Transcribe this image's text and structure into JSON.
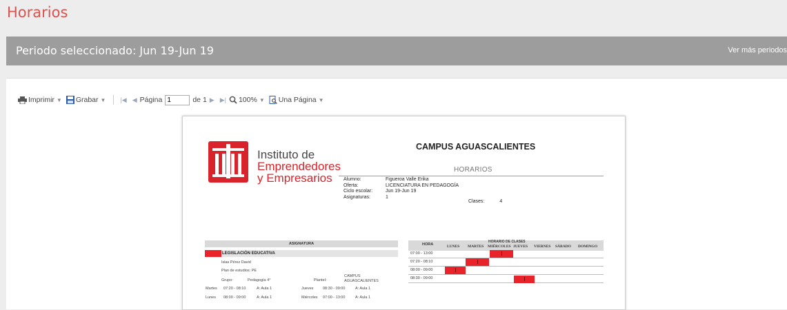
{
  "page": {
    "title": "Horarios",
    "period_label": "Periodo seleccionado: Jun 19-Jun 19",
    "more_periods": "Ver más periodos"
  },
  "toolbar": {
    "print": "Imprimir",
    "save": "Grabar",
    "page_label": "Página",
    "page_value": "1",
    "page_of": "de 1",
    "zoom": "100%",
    "view_mode": "Una Página"
  },
  "report": {
    "institute_line1": "Instituto de",
    "institute_line2": "Emprendedores",
    "institute_line3": "y Empresarios",
    "campus": "CAMPUS AGUASCALIENTES",
    "heading": "HORARIOS",
    "info": [
      {
        "key": "Alumno:",
        "value": "Figueroa Valle Erika"
      },
      {
        "key": "Oferta:",
        "value": "LICENCIATURA EN PEDAGOGÍA"
      },
      {
        "key": "Ciclo escolar:",
        "value": "Jun 19-Jun 19"
      },
      {
        "key": "Asignaturas:",
        "value": "1"
      }
    ],
    "clases_label": "Clases:",
    "clases_value": "4",
    "asignatura_header": "ASIGNATURA",
    "subject": "LEGISLACIÓN EDUCATIVA",
    "teacher": "Islas Pérez David",
    "plan": "Plan de estudios: PE",
    "grupo_label": "Grupo:",
    "grupo_value": "Pedagogía 4°",
    "plantel_label": "Plantel:",
    "plantel_value_1": "CAMPUS",
    "plantel_value_2": "AGUASCALIENTES",
    "sessions": [
      {
        "day": "Martes",
        "time": "07:20 - 08:10",
        "room": "A: Aula 1"
      },
      {
        "day": "Jueves",
        "time": "08:30 - 09:00",
        "room": "A: Aula 1"
      },
      {
        "day": "Lunes",
        "time": "08:00 - 09:00",
        "room": "A: Aula 1"
      },
      {
        "day": "Miércoles",
        "time": "07:00 - 13:00",
        "room": "A: Aula 1"
      }
    ],
    "grid": {
      "hora_header": "HORA",
      "title": "HORARIO DE CLASES",
      "days": [
        "LUNES",
        "MARTES",
        "MIÉRCOLES",
        "JUEVES",
        "VIERNES",
        "SÁBADO",
        "DOMINGO"
      ],
      "rows": [
        "07:00 - 13:00",
        "07:20 - 08:10",
        "08:00 - 09:00",
        "08:30 - 09:00"
      ],
      "accent": "#e8232a"
    }
  },
  "colors": {
    "title_red": "#d9534f",
    "bar_gray": "#9d9d9d",
    "brand_red": "#d8232a"
  }
}
